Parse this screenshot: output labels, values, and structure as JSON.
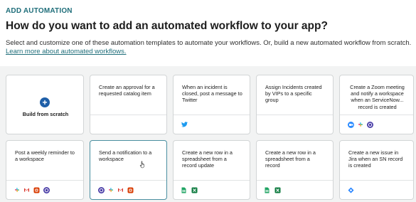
{
  "header": {
    "section_label": "ADD AUTOMATION",
    "title": "How do you want to add an automated workflow to your app?",
    "intro_text": "Select and customize one of these automation templates to automate your workflows. Or, build a new automated workflow from scratch. ",
    "learn_more_link": "Learn more about automated workflows."
  },
  "cards": [
    {
      "title": "Build from scratch",
      "icons": []
    },
    {
      "title": "Create an approval for a requested catalog item",
      "icons": []
    },
    {
      "title": "When an incident is closed, post a message to Twitter",
      "icons": [
        "twitter-icon"
      ]
    },
    {
      "title": "Assign Incidents created by VIPs to a specific group",
      "icons": []
    },
    {
      "title": "Create a Zoom meeting and notify a workspace when an ServiceNow... record is created",
      "icons": [
        "zoom-icon",
        "slack-icon",
        "webex-icon"
      ]
    },
    {
      "title": "Post a weekly reminder to a workspace",
      "icons": [
        "slack-icon",
        "gmail-icon",
        "office-icon",
        "webex-icon"
      ]
    },
    {
      "title": "Send a notification to a workspace",
      "icons": [
        "webex-icon",
        "slack-icon",
        "gmail-icon",
        "office-icon"
      ]
    },
    {
      "title": "Create a new row in a spreadsheet from a record update",
      "icons": [
        "google-sheets-icon",
        "excel-icon"
      ]
    },
    {
      "title": "Create a new row in a spreadsheet from a record",
      "icons": [
        "google-sheets-icon",
        "excel-icon"
      ]
    },
    {
      "title": "Create a new issue in Jira when an SN record is created",
      "icons": [
        "jira-icon"
      ]
    }
  ],
  "colors": {
    "accent": "#1f6e7a",
    "selected_border": "#4a8fa0",
    "plus_button": "#1f5fa8"
  }
}
